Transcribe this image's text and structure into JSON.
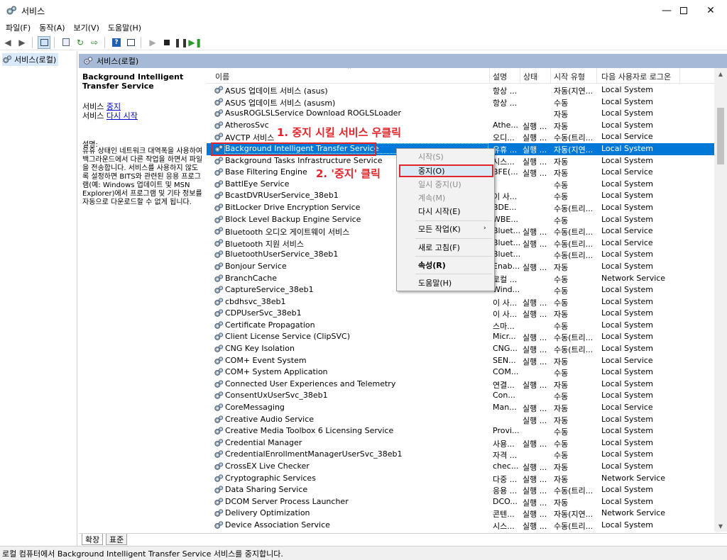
{
  "window": {
    "title": "서비스",
    "min_icon": "minimize-icon",
    "max_icon": "maximize-icon",
    "close_icon": "close-icon"
  },
  "menu": [
    "파일(F)",
    "동작(A)",
    "보기(V)",
    "도움말(H)"
  ],
  "tree": {
    "label": "서비스(로컬)"
  },
  "panel": {
    "header": "서비스(로컬)"
  },
  "description": {
    "title": "Background Intelligent Transfer Service",
    "action_prefix_1": "서비스 ",
    "action_link_1": "중지",
    "action_prefix_2": "서비스 ",
    "action_link_2": "다시 시작",
    "label": "설명:",
    "text": "유휴 상태인 네트워크 대역폭을 사용하여 백그라운드에서 다른 작업을 하면서 파일을 전송합니다. 서비스를 사용하지 않도록 설정하면 BITS와 관련된 응용 프로그램(예: Windows 업데이트 및 MSN Explorer)에서 프로그램 및 기타 정보를 자동으로 다운로드할 수 없게 됩니다."
  },
  "columns": {
    "name": "이름",
    "desc": "설명",
    "state": "상태",
    "start": "시작 유형",
    "logon": "다음 사용자로 로그온"
  },
  "rows": [
    {
      "name": "ASUS 업데이트 서비스 (asus)",
      "desc": "항상 ...",
      "state": "",
      "start": "자동(지연...",
      "logon": "Local System"
    },
    {
      "name": "ASUS 업데이트 서비스 (asusm)",
      "desc": "항상 ...",
      "state": "",
      "start": "수동",
      "logon": "Local System"
    },
    {
      "name": "AsusROGLSLService Download ROGLSLoader",
      "desc": "",
      "state": "",
      "start": "자동",
      "logon": "Local System"
    },
    {
      "name": "AtherosSvc",
      "desc": "Athe...",
      "state": "실행 ...",
      "start": "자동",
      "logon": "Local System"
    },
    {
      "name": "AVCTP 서비스",
      "desc": "오디...",
      "state": "실행 ...",
      "start": "수동(트리...",
      "logon": "Local Service"
    },
    {
      "name": "Background Intelligent Transfer Service",
      "desc": "유휴 ...",
      "state": "실행 ...",
      "start": "자동(지연...",
      "logon": "Local System",
      "selected": true
    },
    {
      "name": "Background Tasks Infrastructure Service",
      "desc": "시스...",
      "state": "실행 ...",
      "start": "자동",
      "logon": "Local System"
    },
    {
      "name": "Base Filtering Engine",
      "desc": "BFE(...",
      "state": "실행 ...",
      "start": "자동",
      "logon": "Local Service"
    },
    {
      "name": "BattlEye Service",
      "desc": "",
      "state": "",
      "start": "수동",
      "logon": "Local System"
    },
    {
      "name": "BcastDVRUserService_38eb1",
      "desc": "이 사...",
      "state": "",
      "start": "수동",
      "logon": "Local System"
    },
    {
      "name": "BitLocker Drive Encryption Service",
      "desc": "BDE...",
      "state": "",
      "start": "수동(트리...",
      "logon": "Local System"
    },
    {
      "name": "Block Level Backup Engine Service",
      "desc": "WBE...",
      "state": "",
      "start": "수동",
      "logon": "Local System"
    },
    {
      "name": "Bluetooth 오디오 게이트웨이 서비스",
      "desc": "Bluet...",
      "state": "실행 ...",
      "start": "수동(트리...",
      "logon": "Local Service"
    },
    {
      "name": "Bluetooth 지원 서비스",
      "desc": "Bluet...",
      "state": "실행 ...",
      "start": "수동(트리...",
      "logon": "Local Service"
    },
    {
      "name": "BluetoothUserService_38eb1",
      "desc": "Bluet...",
      "state": "",
      "start": "수동(트리...",
      "logon": "Local System"
    },
    {
      "name": "Bonjour Service",
      "desc": "Enab...",
      "state": "실행 ...",
      "start": "자동",
      "logon": "Local System"
    },
    {
      "name": "BranchCache",
      "desc": "로컬 ...",
      "state": "",
      "start": "수동",
      "logon": "Network Service"
    },
    {
      "name": "CaptureService_38eb1",
      "desc": "Wind...",
      "state": "",
      "start": "수동",
      "logon": "Local System"
    },
    {
      "name": "cbdhsvc_38eb1",
      "desc": "이 사...",
      "state": "실행 ...",
      "start": "수동",
      "logon": "Local System"
    },
    {
      "name": "CDPUserSvc_38eb1",
      "desc": "이 사...",
      "state": "실행 ...",
      "start": "자동",
      "logon": "Local System"
    },
    {
      "name": "Certificate Propagation",
      "desc": "스마...",
      "state": "",
      "start": "수동",
      "logon": "Local System"
    },
    {
      "name": "Client License Service (ClipSVC)",
      "desc": "Micr...",
      "state": "실행 ...",
      "start": "수동(트리...",
      "logon": "Local System"
    },
    {
      "name": "CNG Key Isolation",
      "desc": "CNG...",
      "state": "실행 ...",
      "start": "수동(트리...",
      "logon": "Local System"
    },
    {
      "name": "COM+ Event System",
      "desc": "SEN...",
      "state": "실행 ...",
      "start": "자동",
      "logon": "Local Service"
    },
    {
      "name": "COM+ System Application",
      "desc": "COM...",
      "state": "",
      "start": "수동",
      "logon": "Local System"
    },
    {
      "name": "Connected User Experiences and Telemetry",
      "desc": "연결...",
      "state": "실행 ...",
      "start": "자동",
      "logon": "Local System"
    },
    {
      "name": "ConsentUxUserSvc_38eb1",
      "desc": "Con...",
      "state": "",
      "start": "수동",
      "logon": "Local System"
    },
    {
      "name": "CoreMessaging",
      "desc": "Man...",
      "state": "실행 ...",
      "start": "자동",
      "logon": "Local Service"
    },
    {
      "name": "Creative Audio Service",
      "desc": "",
      "state": "실행 ...",
      "start": "자동",
      "logon": "Local System"
    },
    {
      "name": "Creative Media Toolbox 6 Licensing Service",
      "desc": "Provi...",
      "state": "",
      "start": "수동",
      "logon": "Local System"
    },
    {
      "name": "Credential Manager",
      "desc": "사용...",
      "state": "실행 ...",
      "start": "수동",
      "logon": "Local System"
    },
    {
      "name": "CredentialEnrollmentManagerUserSvc_38eb1",
      "desc": "자격 ...",
      "state": "",
      "start": "수동",
      "logon": "Local System"
    },
    {
      "name": "CrossEX Live Checker",
      "desc": "chec...",
      "state": "실행 ...",
      "start": "자동",
      "logon": "Local System"
    },
    {
      "name": "Cryptographic Services",
      "desc": "다중 ...",
      "state": "실행 ...",
      "start": "자동",
      "logon": "Network Service"
    },
    {
      "name": "Data Sharing Service",
      "desc": "응용 ...",
      "state": "실행 ...",
      "start": "수동(트리...",
      "logon": "Local System"
    },
    {
      "name": "DCOM Server Process Launcher",
      "desc": "DCO...",
      "state": "실행 ...",
      "start": "자동",
      "logon": "Local System"
    },
    {
      "name": "Delivery Optimization",
      "desc": "콘텐...",
      "state": "실행 ...",
      "start": "자동(지연...",
      "logon": "Network Service"
    },
    {
      "name": "Device Association Service",
      "desc": "시스...",
      "state": "실행 ...",
      "start": "수동(트리...",
      "logon": "Local System"
    }
  ],
  "context_menu": {
    "start": "시작(S)",
    "stop": "중지(O)",
    "pause": "일시 중지(U)",
    "resume": "계속(M)",
    "restart": "다시 시작(E)",
    "all_tasks": "모든 작업(K)",
    "refresh": "새로 고침(F)",
    "properties": "속성(R)",
    "help": "도움말(H)"
  },
  "annotations": {
    "step1": "1. 중지 시킬 서비스 우클릭",
    "step2": "2. '중지' 클릭"
  },
  "tabs": {
    "extended": "확장",
    "standard": "표준"
  },
  "status": "로컬 컴퓨터에서 Background Intelligent Transfer Service 서비스를 중지합니다.",
  "colors": {
    "selection": "#0078d7",
    "header": "#a6b9d6",
    "annotation": "#e0262b"
  }
}
